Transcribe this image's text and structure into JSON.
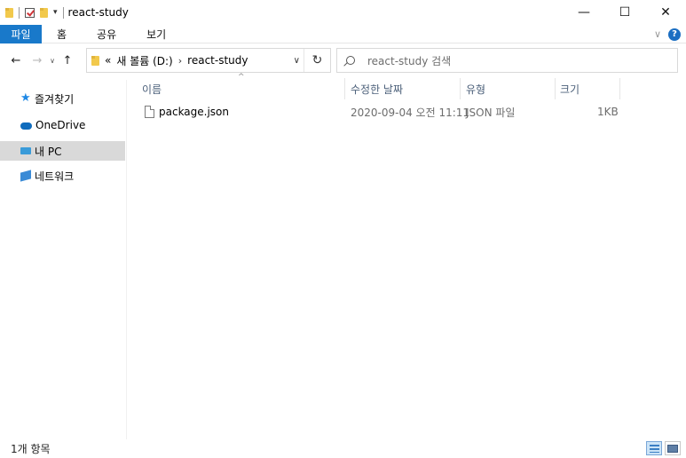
{
  "window": {
    "title": "react-study",
    "controls": {
      "minimize": "—",
      "maximize": "☐",
      "close": "✕"
    }
  },
  "quick_access": {
    "dropdown": "▾"
  },
  "ribbon": {
    "file_tab": "파일",
    "tabs": [
      "홈",
      "공유",
      "보기"
    ],
    "expand": "∨",
    "help": "?"
  },
  "navigation": {
    "back": "←",
    "forward": "→",
    "recent": "∨",
    "up": "↑"
  },
  "address": {
    "overflow": "«",
    "crumbs": [
      "새 볼륨 (D:)",
      "react-study"
    ],
    "separator": "›",
    "dropdown": "∨",
    "refresh": "↻"
  },
  "search": {
    "placeholder": "react-study 검색"
  },
  "sidebar": {
    "items": [
      {
        "label": "즐겨찾기",
        "icon": "star-icon"
      },
      {
        "label": "OneDrive",
        "icon": "cloud-icon"
      },
      {
        "label": "내 PC",
        "icon": "pc-icon"
      },
      {
        "label": "네트워크",
        "icon": "network-icon"
      }
    ]
  },
  "columns": {
    "name": "이름",
    "date": "수정한 날짜",
    "type": "유형",
    "size": "크기",
    "sort_indicator": "^"
  },
  "files": [
    {
      "name": "package.json",
      "date": "2020-09-04 오전 11:11",
      "type": "JSON 파일",
      "size": "1KB"
    }
  ],
  "status": {
    "item_count": "1개 항목"
  }
}
